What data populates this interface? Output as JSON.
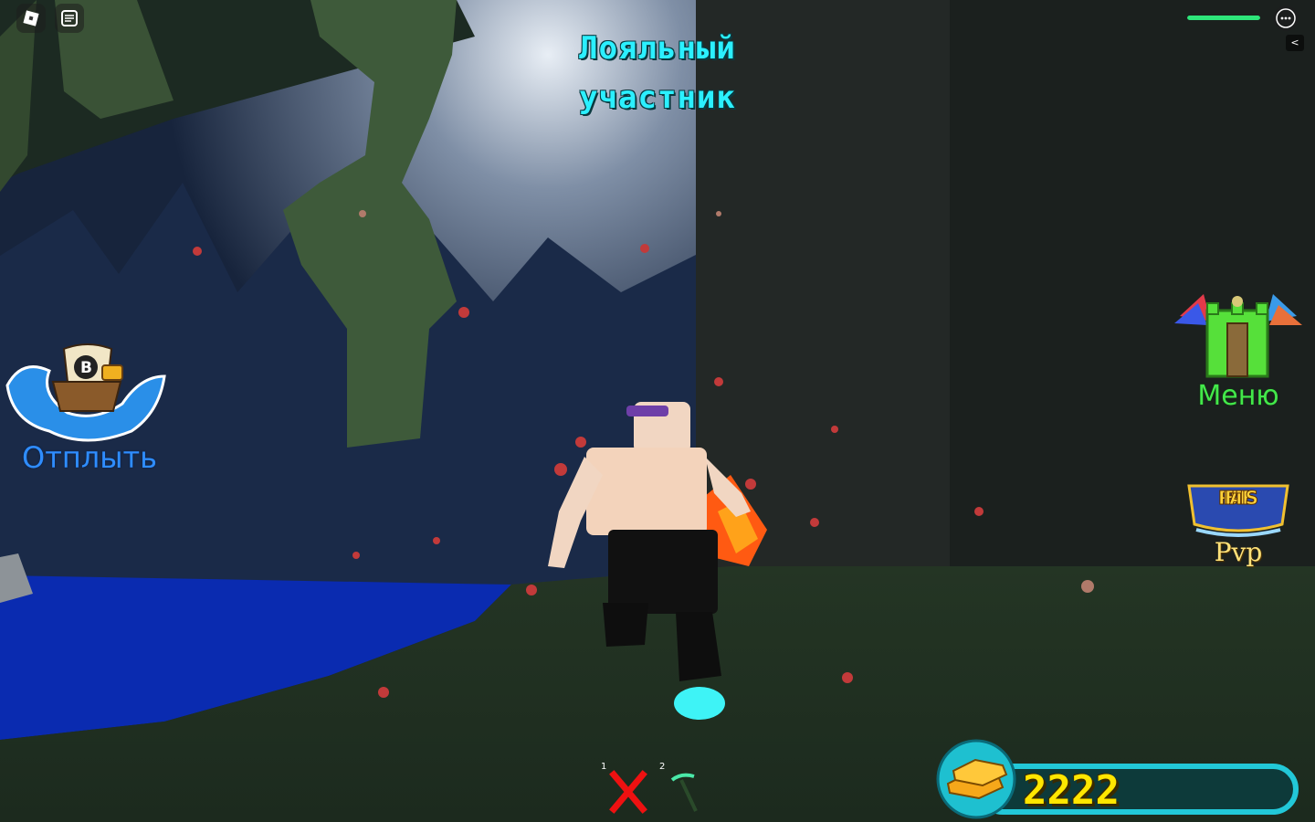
{
  "hud": {
    "rank_title_line1": "Лояльный",
    "rank_title_line2": "участник",
    "collapse_symbol": "<",
    "health_fraction": 1.0
  },
  "buttons": {
    "sail_label": "Отплыть",
    "menu_label": "Меню",
    "pvp_label": "Pvp",
    "pvp_logo_text": "RB BATTLES"
  },
  "hotbar": {
    "slots": [
      {
        "number": "1",
        "icon": "red-x-icon"
      },
      {
        "number": "2",
        "icon": "pickaxe-icon"
      }
    ]
  },
  "currency": {
    "value": "2222",
    "icon": "gold-bars-icon"
  },
  "colors": {
    "title": "#2bf0ff",
    "sail": "#2f8dff",
    "menu": "#43e84a",
    "pvp": "#ffe27a",
    "currency_text": "#ffe600",
    "currency_border": "#22c8d8",
    "health": "#2ee57a"
  }
}
